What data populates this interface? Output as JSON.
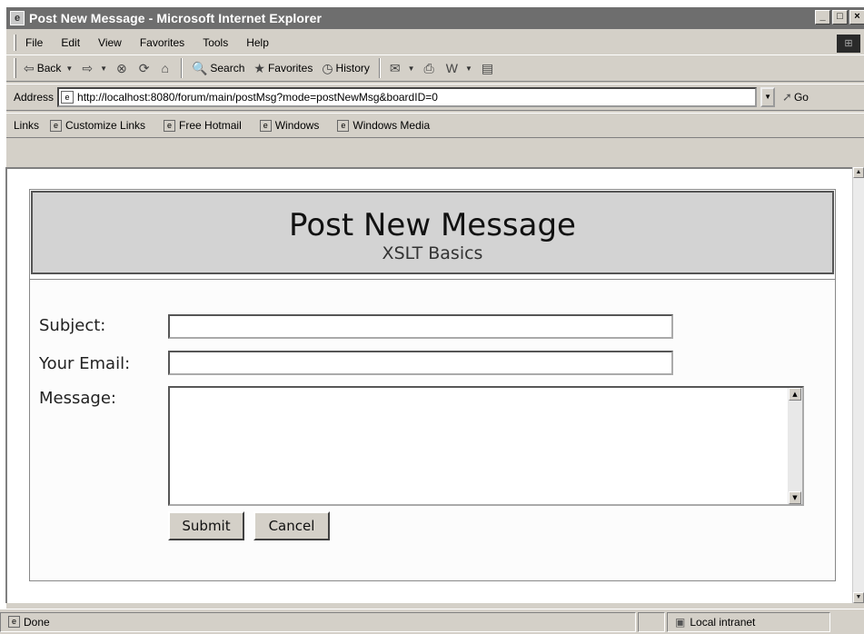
{
  "window": {
    "title": "Post New Message - Microsoft Internet Explorer"
  },
  "menubar": {
    "items": [
      "File",
      "Edit",
      "View",
      "Favorites",
      "Tools",
      "Help"
    ]
  },
  "toolbar": {
    "back": "Back",
    "search": "Search",
    "favorites": "Favorites",
    "history": "History"
  },
  "address": {
    "label": "Address",
    "url": "http://localhost:8080/forum/main/postMsg?mode=postNewMsg&boardID=0",
    "go": "Go"
  },
  "links": {
    "label": "Links",
    "items": [
      "Customize Links",
      "Free Hotmail",
      "Windows",
      "Windows Media"
    ]
  },
  "page": {
    "title": "Post New Message",
    "subtitle": "XSLT Basics",
    "subject_label": "Subject:",
    "email_label": "Your Email:",
    "message_label": "Message:",
    "subject_value": "",
    "email_value": "",
    "message_value": "",
    "submit": "Submit",
    "cancel": "Cancel"
  },
  "status": {
    "text": "Done",
    "zone": "Local intranet"
  }
}
